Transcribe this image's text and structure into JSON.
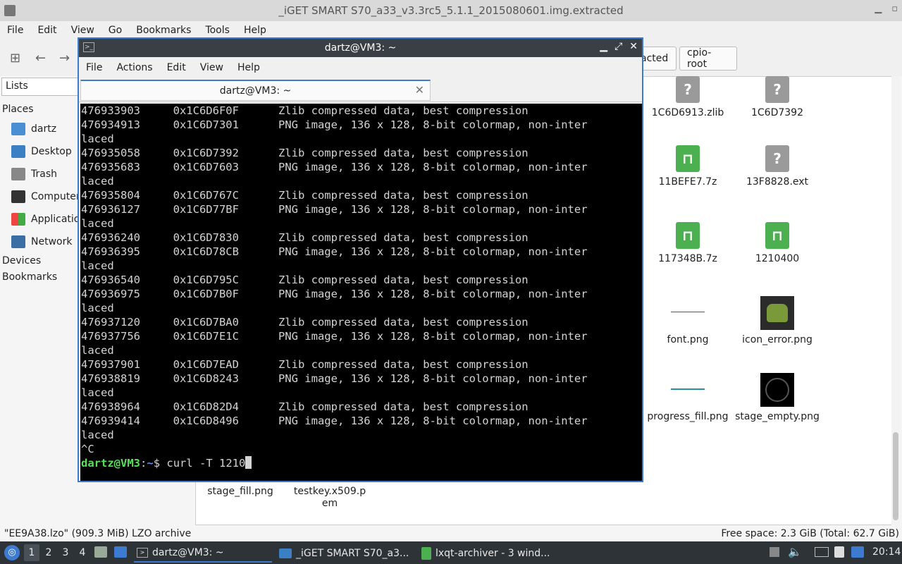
{
  "window_title": "_iGET SMART S70_a33_v3.3rc5_5.1.1_2015080601.img.extracted",
  "fm_menu": [
    "File",
    "Edit",
    "View",
    "Go",
    "Bookmarks",
    "Tools",
    "Help"
  ],
  "fm_tabs": [
    "acted",
    "cpio-root"
  ],
  "sidebar": {
    "combo": "Lists",
    "places_header": "Places",
    "places": [
      "dartz",
      "Desktop",
      "Trash",
      "Computer",
      "Applicatio",
      "Network"
    ],
    "devices_header": "Devices",
    "bookmarks_header": "Bookmarks"
  },
  "files": [
    {
      "name": "1C6D6913.zlib",
      "icon": "question-file-icon"
    },
    {
      "name": "1C6D7392",
      "icon": "question-file-icon"
    },
    {
      "name": "11BEFE7.7z",
      "icon": "archive-icon"
    },
    {
      "name": "13F8828.ext",
      "icon": "question-file-icon"
    },
    {
      "name": "117348B.7z",
      "icon": "archive-icon"
    },
    {
      "name": "1210400",
      "icon": "archive-icon"
    },
    {
      "name": "font.png",
      "icon": "image-icon"
    },
    {
      "name": "icon_error.png",
      "icon": "image-icon"
    },
    {
      "name": "progress_fill.png",
      "icon": "image-icon"
    },
    {
      "name": "stage_empty.png",
      "icon": "image-icon"
    },
    {
      "name": "stage_fill.png",
      "icon": "image-icon"
    },
    {
      "name": "testkey.x509.pem",
      "icon": "text-file-icon"
    }
  ],
  "status": {
    "left": "\"EE9A38.lzo\" (909.3 MiB) LZO archive",
    "right": "Free space: 2.3 GiB (Total: 62.7 GiB)"
  },
  "terminal": {
    "title": "dartz@VM3: ~",
    "menu": [
      "File",
      "Actions",
      "Edit",
      "View",
      "Help"
    ],
    "tab_label": "dartz@VM3: ~",
    "lines": [
      "476933903     0x1C6D6F0F      Zlib compressed data, best compression",
      "476934913     0x1C6D7301      PNG image, 136 x 128, 8-bit colormap, non-inter",
      "laced",
      "476935058     0x1C6D7392      Zlib compressed data, best compression",
      "476935683     0x1C6D7603      PNG image, 136 x 128, 8-bit colormap, non-inter",
      "laced",
      "476935804     0x1C6D767C      Zlib compressed data, best compression",
      "476936127     0x1C6D77BF      PNG image, 136 x 128, 8-bit colormap, non-inter",
      "laced",
      "476936240     0x1C6D7830      Zlib compressed data, best compression",
      "476936395     0x1C6D78CB      PNG image, 136 x 128, 8-bit colormap, non-inter",
      "laced",
      "476936540     0x1C6D795C      Zlib compressed data, best compression",
      "476936975     0x1C6D7B0F      PNG image, 136 x 128, 8-bit colormap, non-inter",
      "laced",
      "476937120     0x1C6D7BA0      Zlib compressed data, best compression",
      "476937756     0x1C6D7E1C      PNG image, 136 x 128, 8-bit colormap, non-inter",
      "laced",
      "476937901     0x1C6D7EAD      Zlib compressed data, best compression",
      "476938819     0x1C6D8243      PNG image, 136 x 128, 8-bit colormap, non-inter",
      "laced",
      "476938964     0x1C6D82D4      Zlib compressed data, best compression",
      "476939414     0x1C6D8496      PNG image, 136 x 128, 8-bit colormap, non-inter",
      "laced",
      "^C"
    ],
    "prompt_user": "dartz@VM3",
    "prompt_sep": ":",
    "prompt_path": "~",
    "prompt_symbol": "$ ",
    "command": "curl -T 1210"
  },
  "taskbar": {
    "desktops": [
      "1",
      "2",
      "3",
      "4"
    ],
    "tasks": [
      "dartz@VM3: ~",
      "_iGET SMART S70_a3...",
      "lxqt-archiver - 3 wind..."
    ],
    "clock": "20:14"
  },
  "colors": {
    "accent": "#3d7bd0",
    "prompt_user": "#55e355",
    "prompt_path": "#5c8cff"
  }
}
